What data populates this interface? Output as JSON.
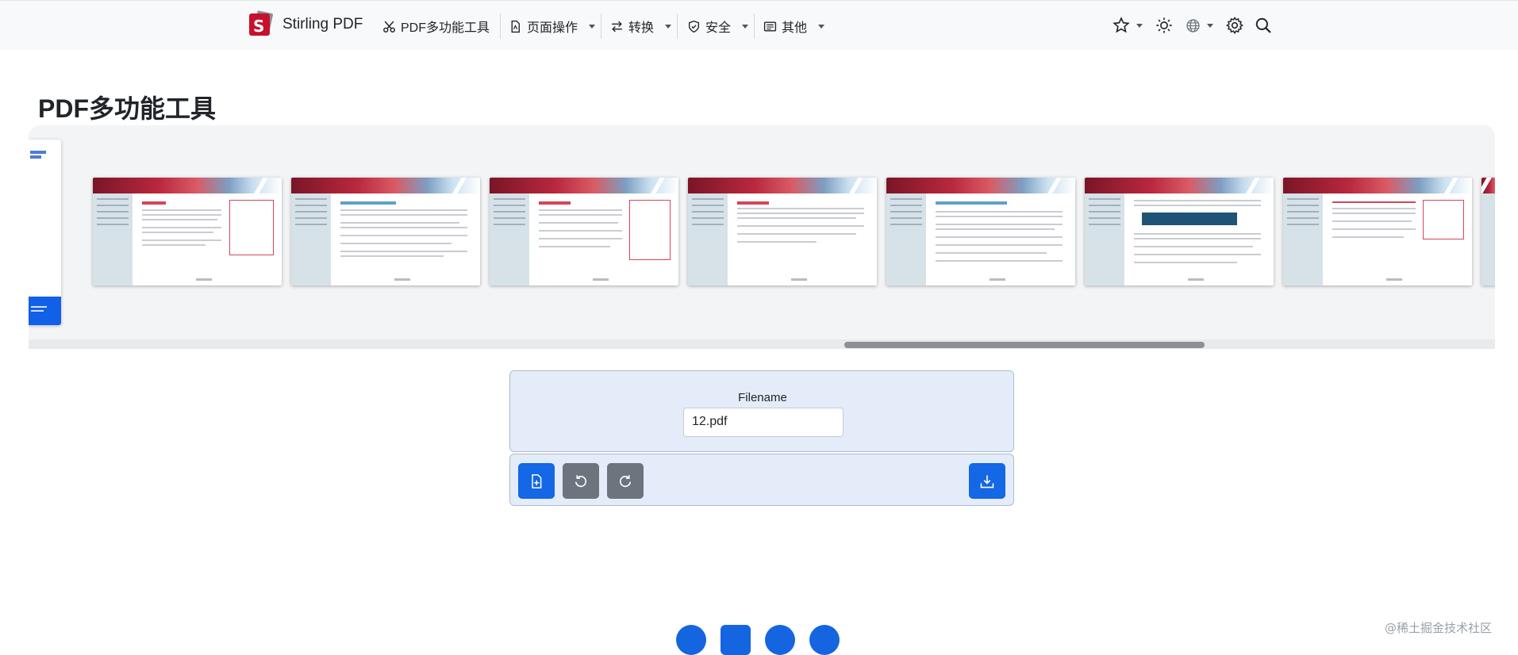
{
  "nav": {
    "brand": "Stirling PDF",
    "items": [
      {
        "label": "PDF多功能工具",
        "icon": "scissors-icon"
      },
      {
        "label": "页面操作",
        "icon": "file-icon"
      },
      {
        "label": "转换",
        "icon": "arrows-swap-icon"
      },
      {
        "label": "安全",
        "icon": "shield-icon"
      },
      {
        "label": "其他",
        "icon": "card-list-icon"
      }
    ],
    "right_icons": [
      "star-icon",
      "sun-icon",
      "globe-icon",
      "gear-icon",
      "search-icon"
    ]
  },
  "page": {
    "title": "PDF多功能工具"
  },
  "viewer": {
    "page_count_visible": 8,
    "scroll_position": 0.56
  },
  "filename_panel": {
    "label": "Filename",
    "value": "12.pdf"
  },
  "toolbar": {
    "buttons": [
      "add-file-icon",
      "rotate-left-icon",
      "rotate-right-icon",
      "download-icon"
    ]
  },
  "footer": {
    "icons": [
      "github-icon",
      "docker-icon",
      "discord-icon",
      "heart-icon"
    ]
  },
  "watermark": "@稀土掘金技术社区",
  "colors": {
    "primary": "#1467e5",
    "secondary": "#6c757d",
    "panel_bg": "#e4ecf9",
    "navbar_bg": "#f8f9fa"
  }
}
